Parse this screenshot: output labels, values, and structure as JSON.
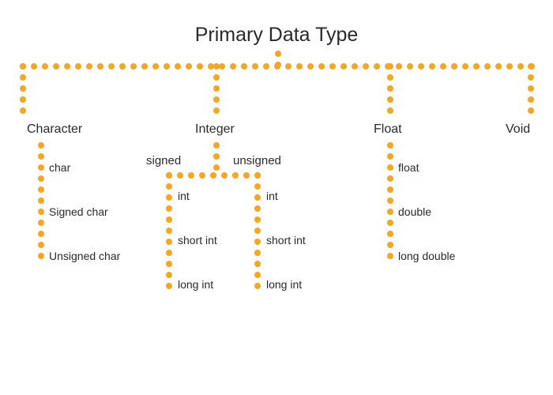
{
  "title": "Primary Data Type",
  "branches": {
    "character": {
      "label": "Character",
      "leaves": [
        "char",
        "Signed char",
        "Unsigned char"
      ]
    },
    "integer": {
      "label": "Integer",
      "signed": {
        "label": "signed",
        "leaves": [
          "int",
          "short int",
          "long int"
        ]
      },
      "unsigned": {
        "label": "unsigned",
        "leaves": [
          "int",
          "short int",
          "long int"
        ]
      }
    },
    "float": {
      "label": "Float",
      "leaves": [
        "float",
        "double",
        "long double"
      ]
    },
    "void": {
      "label": "Void"
    }
  }
}
